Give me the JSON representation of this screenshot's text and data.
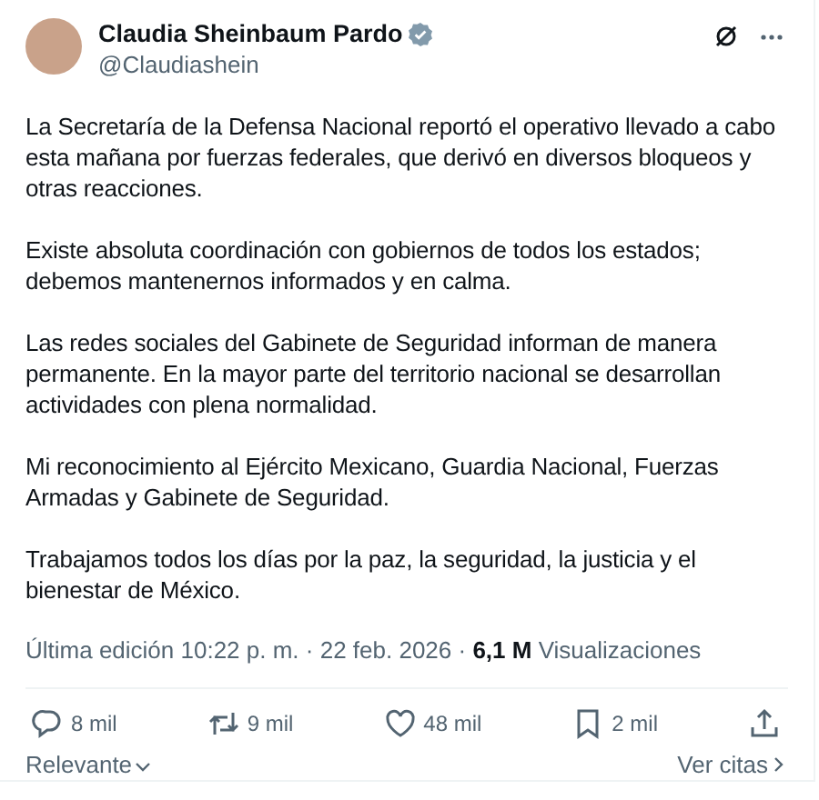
{
  "author": {
    "name": "Claudia Sheinbaum Pardo",
    "verified": true,
    "handle": "@Claudiashein"
  },
  "paragraphs": [
    "La Secretaría de la Defensa Nacional reportó el operativo llevado a cabo esta mañana por fuerzas federales, que derivó en diversos bloqueos y otras reacciones.",
    "Existe absoluta coordinación con gobiernos de todos los estados; debemos mantenernos informados y en calma.",
    "Las redes sociales del Gabinete de Seguridad informan de manera permanente. En la mayor parte del territorio nacional se desarrollan actividades con plena normalidad.",
    "Mi reconocimiento al Ejército Mexicano, Guardia Nacional, Fuerzas Armadas y Gabinete de Seguridad.",
    "Trabajamos todos los días por la paz, la seguridad, la justicia y el bienestar de México."
  ],
  "meta": "Última edición 10:22 p. m. · 22 feb. 2026 · **6,1 M** Visualizaciones",
  "actions": [
    {
      "kind": "reply",
      "count": "8 mil"
    },
    {
      "kind": "repost",
      "count": "9 mil"
    },
    {
      "kind": "like",
      "count": "48 mil"
    },
    {
      "kind": "bookmark",
      "count": "2 mil"
    },
    {
      "kind": "share"
    }
  ],
  "sort": "Relevante",
  "quotes_link": "Ver citas"
}
